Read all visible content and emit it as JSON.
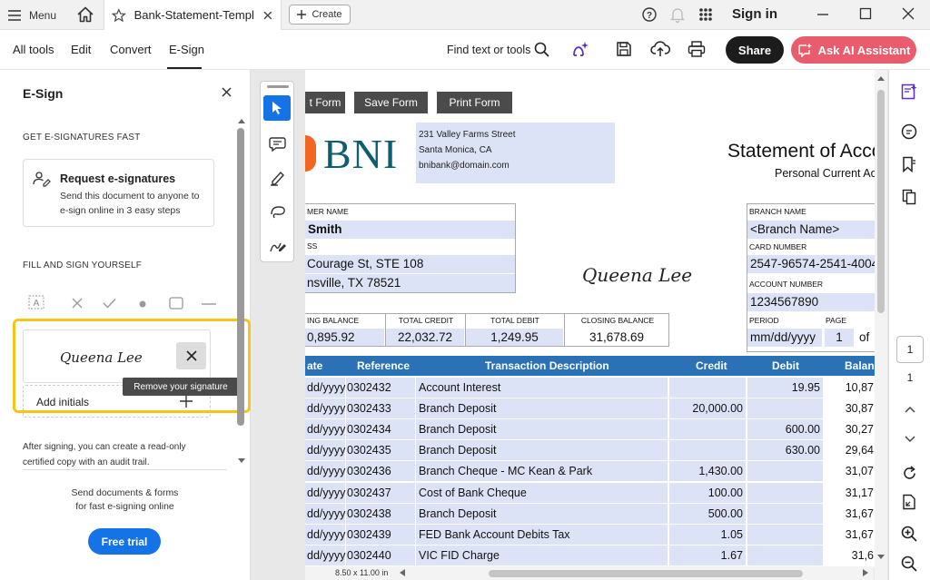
{
  "titlebar": {
    "menu_label": "Menu",
    "tab_title": "Bank-Statement-Templ...",
    "create_label": "Create",
    "sign_in": "Sign in"
  },
  "toolbar": {
    "tabs": [
      "All tools",
      "Edit",
      "Convert",
      "E-Sign"
    ],
    "active_tab": "E-Sign",
    "find_text": "Find text or tools",
    "share": "Share",
    "ai_assistant": "Ask AI Assistant"
  },
  "left_panel": {
    "title": "E-Sign",
    "section1": "GET E-SIGNATURES FAST",
    "request_title": "Request e-signatures",
    "request_desc1": "Send this document to anyone to",
    "request_desc2": "e-sign online in 3 easy steps",
    "section2": "FILL AND SIGN YOURSELF",
    "signature_text": "Queena Lee",
    "tooltip": "Remove your signature",
    "add_initials": "Add initials",
    "after_sign1": "After signing, you can create a read-only",
    "after_sign2": "certified copy with an audit trail.",
    "send_docs1": "Send documents & forms",
    "send_docs2": "for fast e-signing online",
    "free_trial": "Free trial"
  },
  "document": {
    "form_buttons": [
      "t Form",
      "Save Form",
      "Print Form"
    ],
    "bank_logo": "BNI",
    "address1": "231 Valley Farms Street",
    "address2": "Santa Monica, CA",
    "email": "bnibank@domain.com",
    "statement_title": "Statement of Acco",
    "statement_sub": "Personal Current Ac",
    "customer_name_label": "MER NAME",
    "customer_name": "Smith",
    "address_label": "SS",
    "addr_line1": "Courage St, STE 108",
    "addr_line2": "nsville, TX 78521",
    "signature": "Queena Lee",
    "branch_name_label": "BRANCH NAME",
    "branch_name": "<Branch Name>",
    "card_number_label": "CARD NUMBER",
    "card_number": "2547-96574-2541-4004",
    "account_number_label": "ACCOUNT NUMBER",
    "account_number": "1234567890",
    "period_label": "PERIOD",
    "period": "mm/dd/yyyy",
    "page_label": "PAGE",
    "page_value": "1",
    "page_of": "of",
    "opening_label": "ING BALANCE",
    "opening": "0,895.92",
    "total_credit_label": "TOTAL CREDIT",
    "total_credit": "22,032.72",
    "total_debit_label": "TOTAL DEBIT",
    "total_debit": "1,249.95",
    "closing_label": "CLOSING BALANCE",
    "closing": "31,678.69",
    "tx_headers": [
      "ate",
      "Reference",
      "Transaction Description",
      "Credit",
      "Debit",
      "Balan"
    ],
    "transactions": [
      {
        "date": "dd/yyyy",
        "ref": "0302432",
        "desc": "Account Interest",
        "credit": "",
        "debit": "19.95",
        "balance": "10,87"
      },
      {
        "date": "dd/yyyy",
        "ref": "0302433",
        "desc": "Branch Deposit",
        "credit": "20,000.00",
        "debit": "",
        "balance": "30,87"
      },
      {
        "date": "dd/yyyy",
        "ref": "0302434",
        "desc": "Branch Deposit",
        "credit": "",
        "debit": "600.00",
        "balance": "30,27"
      },
      {
        "date": "dd/yyyy",
        "ref": "0302435",
        "desc": "Branch Deposit",
        "credit": "",
        "debit": "630.00",
        "balance": "29,64"
      },
      {
        "date": "dd/yyyy",
        "ref": "0302436",
        "desc": "Branch Cheque - MC Kean & Park",
        "credit": "1,430.00",
        "debit": "",
        "balance": "31,07"
      },
      {
        "date": "dd/yyyy",
        "ref": "0302437",
        "desc": "Cost of Bank Cheque",
        "credit": "100.00",
        "debit": "",
        "balance": "31,17"
      },
      {
        "date": "dd/yyyy",
        "ref": "0302438",
        "desc": "Branch Deposit",
        "credit": "500.00",
        "debit": "",
        "balance": "31,67"
      },
      {
        "date": "dd/yyyy",
        "ref": "0302439",
        "desc": "FED Bank Account Debits Tax",
        "credit": "1.05",
        "debit": "",
        "balance": "31,67"
      },
      {
        "date": "dd/yyyy",
        "ref": "0302440",
        "desc": "VIC FID Charge",
        "credit": "1.67",
        "debit": "",
        "balance": "31,6"
      }
    ],
    "page_size": "8.50 x 11.00 in"
  },
  "right_rail": {
    "current_page": "1",
    "total_pages": "1"
  },
  "colors": {
    "accent_blue": "#1473e6",
    "ai_button": "#e85c6d",
    "highlight": "#f5c518",
    "table_header": "#2a72b5",
    "form_field": "#dde3f6",
    "bni_orange": "#f26522",
    "bni_teal": "#0d5e6e"
  }
}
